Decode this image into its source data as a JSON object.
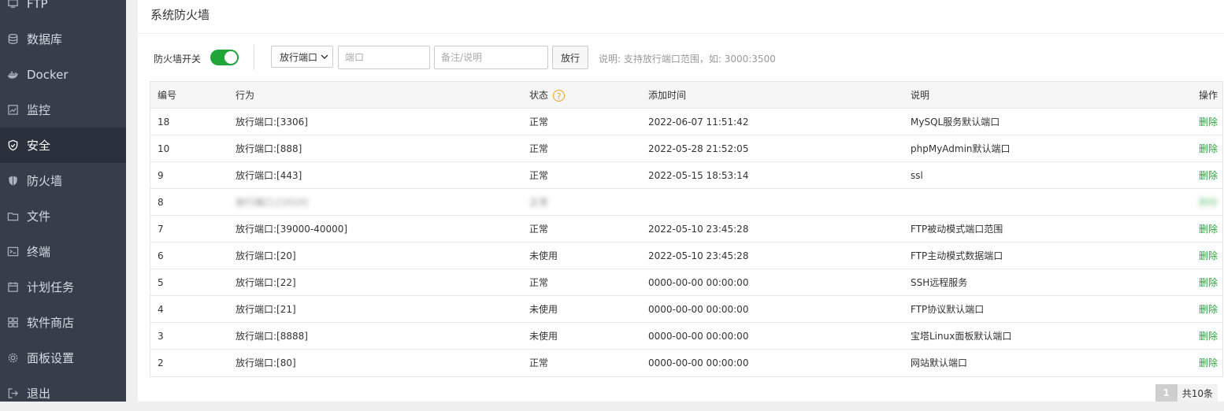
{
  "sidebar": {
    "items": [
      {
        "label": "FTP",
        "icon": "ftp-icon"
      },
      {
        "label": "数据库",
        "icon": "database-icon"
      },
      {
        "label": "Docker",
        "icon": "docker-icon"
      },
      {
        "label": "监控",
        "icon": "monitor-icon"
      },
      {
        "label": "安全",
        "icon": "shield-icon",
        "active": true
      },
      {
        "label": "防火墙",
        "icon": "firewall-icon"
      },
      {
        "label": "文件",
        "icon": "folder-icon"
      },
      {
        "label": "终端",
        "icon": "terminal-icon"
      },
      {
        "label": "计划任务",
        "icon": "calendar-icon"
      },
      {
        "label": "软件商店",
        "icon": "grid-icon"
      },
      {
        "label": "面板设置",
        "icon": "gear-icon"
      },
      {
        "label": "退出",
        "icon": "logout-icon"
      }
    ]
  },
  "page": {
    "title": "系统防火墙"
  },
  "toolbar": {
    "firewall_switch_label": "防火墙开关",
    "firewall_enabled": true,
    "select_value": "放行端口",
    "port_placeholder": "端口",
    "note_placeholder": "备注/说明",
    "allow_button": "放行",
    "hint": "说明: 支持放行端口范围，如: 3000:3500"
  },
  "table": {
    "headers": {
      "id": "编号",
      "action": "行为",
      "status": "状态",
      "time": "添加时间",
      "desc": "说明",
      "op": "操作"
    },
    "rows": [
      {
        "id": "18",
        "action": "放行端口:[3306]",
        "status": "正常",
        "time": "2022-06-07 11:51:42",
        "desc": "MySQL服务默认端口",
        "op": "删除"
      },
      {
        "id": "10",
        "action": "放行端口:[888]",
        "status": "正常",
        "time": "2022-05-28 21:52:05",
        "desc": "phpMyAdmin默认端口",
        "op": "删除"
      },
      {
        "id": "9",
        "action": "放行端口:[443]",
        "status": "正常",
        "time": "2022-05-15 18:53:14",
        "desc": "ssl",
        "op": "删除"
      },
      {
        "id": "8",
        "action": "放行端口:[1010]",
        "status": "正常",
        "time": "",
        "desc": "",
        "op": "删除",
        "redacted": true
      },
      {
        "id": "7",
        "action": "放行端口:[39000-40000]",
        "status": "正常",
        "time": "2022-05-10 23:45:28",
        "desc": "FTP被动模式端口范围",
        "op": "删除"
      },
      {
        "id": "6",
        "action": "放行端口:[20]",
        "status": "未使用",
        "time": "2022-05-10 23:45:28",
        "desc": "FTP主动模式数据端口",
        "op": "删除"
      },
      {
        "id": "5",
        "action": "放行端口:[22]",
        "status": "正常",
        "time": "0000-00-00 00:00:00",
        "desc": "SSH远程服务",
        "op": "删除"
      },
      {
        "id": "4",
        "action": "放行端口:[21]",
        "status": "未使用",
        "time": "0000-00-00 00:00:00",
        "desc": "FTP协议默认端口",
        "op": "删除"
      },
      {
        "id": "3",
        "action": "放行端口:[8888]",
        "status": "未使用",
        "time": "0000-00-00 00:00:00",
        "desc": "宝塔Linux面板默认端口",
        "op": "删除"
      },
      {
        "id": "2",
        "action": "放行端口:[80]",
        "status": "正常",
        "time": "0000-00-00 00:00:00",
        "desc": "网站默认端口",
        "op": "删除"
      }
    ]
  },
  "pagination": {
    "current": "1",
    "total": "共10条"
  },
  "colors": {
    "sidebar_bg": "#363e4b",
    "accent_green": "#20a53a",
    "help_orange": "#f0a020"
  }
}
